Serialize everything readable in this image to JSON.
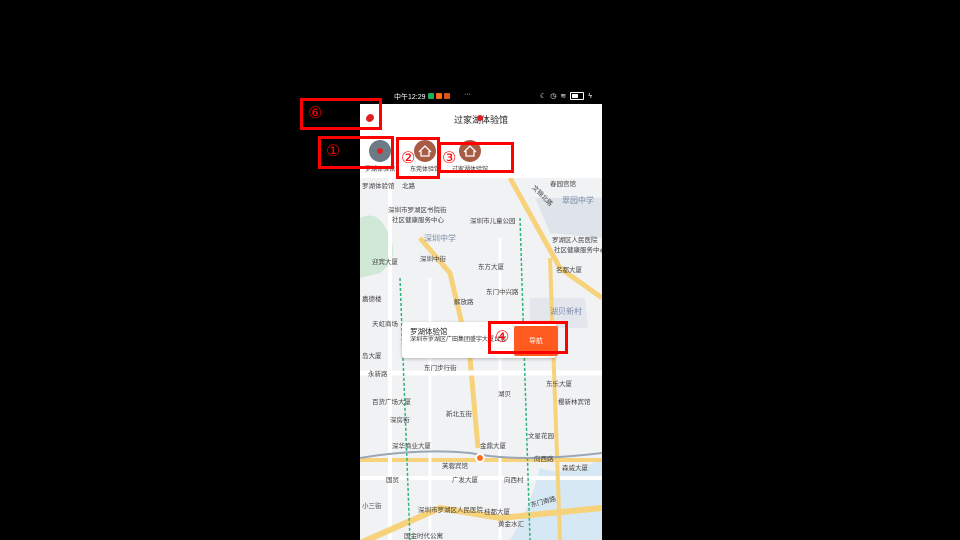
{
  "status_bar": {
    "time": "中午12:29",
    "more": "···"
  },
  "header": {
    "title": "过家湖体验馆"
  },
  "stores": [
    {
      "label": "罗湖体验馆"
    },
    {
      "label": "东莞体验馆"
    },
    {
      "label": "过家湖体验馆"
    }
  ],
  "map": {
    "labels": {
      "l1": "罗湖体验馆",
      "l2": "深圳市罗湖区书院街",
      "l3": "社区健康服务中心",
      "l4": "深圳中学",
      "l5": "深圳市儿童公园",
      "l6": "翠园中学",
      "l7": "春园宫馆",
      "l8": "文锦北路",
      "l9": "深圳中街",
      "l10": "迎宾大厦",
      "l11": "东方大厦",
      "l12": "罗湖区人民医院",
      "l13": "社区健康服务中心",
      "l14": "名都大厦",
      "l15": "东门中兴路",
      "l16": "解放路",
      "l17": "湖贝新村",
      "l18": "天虹商场",
      "l19": "嘉德楼",
      "l20": "岛大厦",
      "l21": "永新路",
      "l22": "东门步行街",
      "l23": "东乐大厦",
      "l24": "湖贝",
      "l25": "百货广场大厦",
      "l26": "深房街",
      "l27": "新北五街",
      "l28": "樱新林宾馆",
      "l29": "深华商业大厦",
      "l30": "金鼎大厦",
      "l31": "文星花园",
      "l32": "芙蓉宾馆",
      "l33": "向西路",
      "l34": "广发大厦",
      "l35": "森威大厦",
      "l36": "向西村",
      "l37": "深圳市罗湖区人民医院",
      "l38": "桂都大厦",
      "l39": "东门南路",
      "l40": "黄金水汇",
      "l41": "小三街",
      "l42": "国贸",
      "l43": "国金时代公寓",
      "l44": "北路"
    }
  },
  "info_card": {
    "name": "罗湖体验馆",
    "address": "深圳市罗湖区广田集团盛宇大厦11层",
    "nav_label": "导航"
  },
  "annotations": [
    "⑥",
    "①",
    "②",
    "③",
    "④"
  ],
  "colors": {
    "accent": "#ff5a1f",
    "annotation": "#ff0000",
    "map_bg": "#f1f2f4"
  }
}
